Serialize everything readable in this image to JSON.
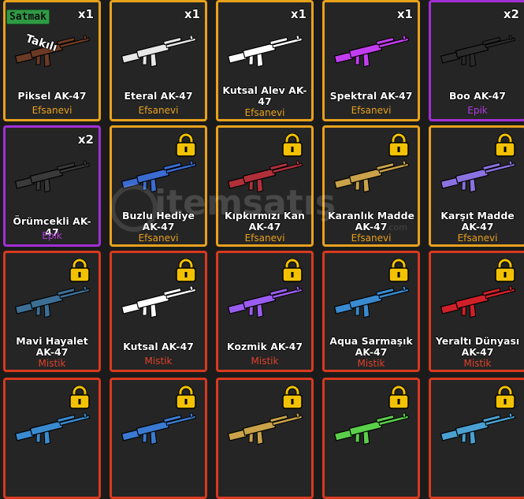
{
  "inventory": {
    "sell_button_label": "Satmak",
    "equipped_label": "Takılı",
    "items": [
      {
        "name": "Piksel AK-47",
        "rarity": "Efsanevi",
        "qty": "x1",
        "tier": "leg",
        "locked": false,
        "color": "#6b3a25"
      },
      {
        "name": "Eteral AK-47",
        "rarity": "Efsanevi",
        "qty": "x1",
        "tier": "leg",
        "locked": false,
        "color": "#e8e8e8"
      },
      {
        "name": "Kutsal Alev AK-47",
        "rarity": "Efsanevi",
        "qty": "x1",
        "tier": "leg",
        "locked": false,
        "color": "#ffffff"
      },
      {
        "name": "Spektral AK-47",
        "rarity": "Efsanevi",
        "qty": "x1",
        "tier": "leg",
        "locked": false,
        "color": "#c23df0"
      },
      {
        "name": "Boo AK-47",
        "rarity": "Epik",
        "qty": "x2",
        "tier": "epic",
        "locked": false,
        "color": "#2a2a2a"
      },
      {
        "name": "Örümcekli AK-47",
        "rarity": "Epik",
        "qty": "x2",
        "tier": "epic",
        "locked": false,
        "color": "#3a3a3a"
      },
      {
        "name": "Buzlu Hediye AK-47",
        "rarity": "Efsanevi",
        "qty": "",
        "tier": "leg",
        "locked": true,
        "color": "#3b6bd0"
      },
      {
        "name": "Kıpkırmızı Kan AK-47",
        "rarity": "Efsanevi",
        "qty": "",
        "tier": "leg",
        "locked": true,
        "color": "#b0303a"
      },
      {
        "name": "Karanlık Madde AK-47",
        "rarity": "Efsanevi",
        "qty": "",
        "tier": "leg",
        "locked": true,
        "color": "#c9a24a"
      },
      {
        "name": "Karşıt Madde AK-47",
        "rarity": "Efsanevi",
        "qty": "",
        "tier": "leg",
        "locked": true,
        "color": "#8a72e0"
      },
      {
        "name": "Mavi Hayalet AK-47",
        "rarity": "Mistik",
        "qty": "",
        "tier": "myth",
        "locked": true,
        "color": "#3d6f95"
      },
      {
        "name": "Kutsal AK-47",
        "rarity": "Mistik",
        "qty": "",
        "tier": "myth",
        "locked": true,
        "color": "#ffffff"
      },
      {
        "name": "Kozmik AK-47",
        "rarity": "Mistik",
        "qty": "",
        "tier": "myth",
        "locked": true,
        "color": "#9a5cf0"
      },
      {
        "name": "Aqua Sarmaşık AK-47",
        "rarity": "Mistik",
        "qty": "",
        "tier": "myth",
        "locked": true,
        "color": "#3a8ad0"
      },
      {
        "name": "Yeraltı Dünyası AK-47",
        "rarity": "Mistik",
        "qty": "",
        "tier": "myth",
        "locked": true,
        "color": "#d0202a"
      },
      {
        "name": "",
        "rarity": "",
        "qty": "",
        "tier": "myth",
        "locked": true,
        "color": "#3a8ad0"
      },
      {
        "name": "",
        "rarity": "",
        "qty": "",
        "tier": "myth",
        "locked": true,
        "color": "#3a7ad0"
      },
      {
        "name": "",
        "rarity": "",
        "qty": "",
        "tier": "myth",
        "locked": true,
        "color": "#c9a24a"
      },
      {
        "name": "",
        "rarity": "",
        "qty": "",
        "tier": "myth",
        "locked": true,
        "color": "#5ad04a"
      },
      {
        "name": "",
        "rarity": "",
        "qty": "",
        "tier": "myth",
        "locked": true,
        "color": "#4aa0d0"
      }
    ]
  },
  "watermark": {
    "text": "itemsatış",
    "sub": ".com"
  }
}
